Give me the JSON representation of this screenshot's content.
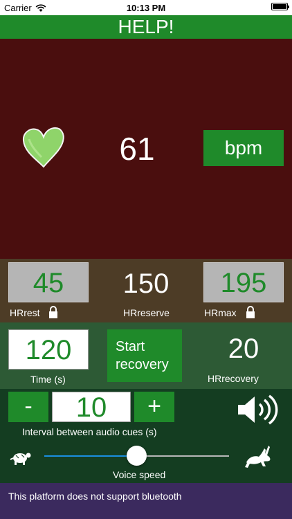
{
  "status": {
    "carrier": "Carrier",
    "time": "10:13 PM"
  },
  "header": {
    "title": "HELP!"
  },
  "heart_rate": {
    "value": "61",
    "unit_button": "bpm"
  },
  "zones": {
    "hr_rest": {
      "value": "45",
      "label": "HRrest"
    },
    "hr_reserve": {
      "value": "150",
      "label": "HRreserve"
    },
    "hr_max": {
      "value": "195",
      "label": "HRmax"
    }
  },
  "recovery": {
    "time_value": "120",
    "time_label": "Time (s)",
    "start_label_line1": "Start",
    "start_label_line2": "recovery",
    "hr_recovery_value": "20",
    "hr_recovery_label": "HRrecovery"
  },
  "audio": {
    "minus_label": "-",
    "interval_value": "10",
    "plus_label": "+",
    "interval_label": "Interval between audio cues (s)",
    "voice_speed_label": "Voice speed",
    "voice_speed_level": 0.5
  },
  "bluetooth": {
    "message": "This platform does not support bluetooth"
  },
  "colors": {
    "accent_green": "#1f8a2a",
    "hr_panel": "#4a0e0e",
    "zones_panel": "#4d3c26",
    "recovery_panel": "#2d5a35",
    "audio_panel": "#143d21",
    "bluetooth_panel": "#3b2a5e"
  },
  "icons": [
    "wifi-icon",
    "battery-icon",
    "heart-icon",
    "lock-icon",
    "speaker-icon",
    "turtle-icon",
    "rabbit-icon"
  ]
}
